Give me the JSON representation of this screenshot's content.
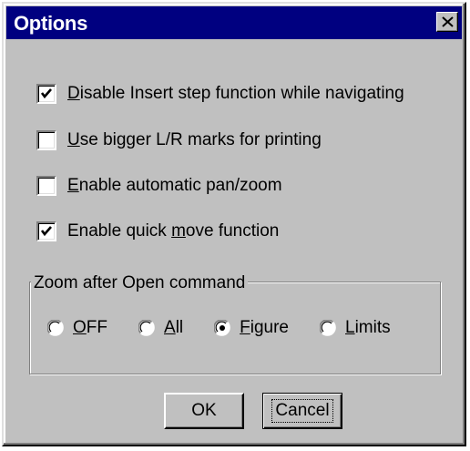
{
  "window": {
    "title": "Options",
    "close_icon": "close-x-icon"
  },
  "options": [
    {
      "mnemonic": "D",
      "rest": "isable Insert step function while navigating",
      "checked": true
    },
    {
      "mnemonic": "U",
      "rest": "se bigger L/R marks for printing",
      "checked": false
    },
    {
      "mnemonic": "E",
      "rest": "nable automatic pan/zoom",
      "checked": false
    },
    {
      "before": "Enable quick ",
      "mnemonic": "m",
      "rest": "ove function",
      "checked": true
    }
  ],
  "zoom_group": {
    "title": "Zoom after Open command",
    "radios": [
      {
        "mnemonic": "O",
        "rest": "FF",
        "selected": false
      },
      {
        "mnemonic": "A",
        "rest": "ll",
        "selected": false
      },
      {
        "mnemonic": "F",
        "rest": "igure",
        "selected": true
      },
      {
        "mnemonic": "L",
        "rest": "imits",
        "selected": false
      }
    ]
  },
  "buttons": {
    "ok_label": "OK",
    "cancel_label": "Cancel"
  },
  "colors": {
    "titlebar": "#000080",
    "face": "#c0c0c0"
  }
}
